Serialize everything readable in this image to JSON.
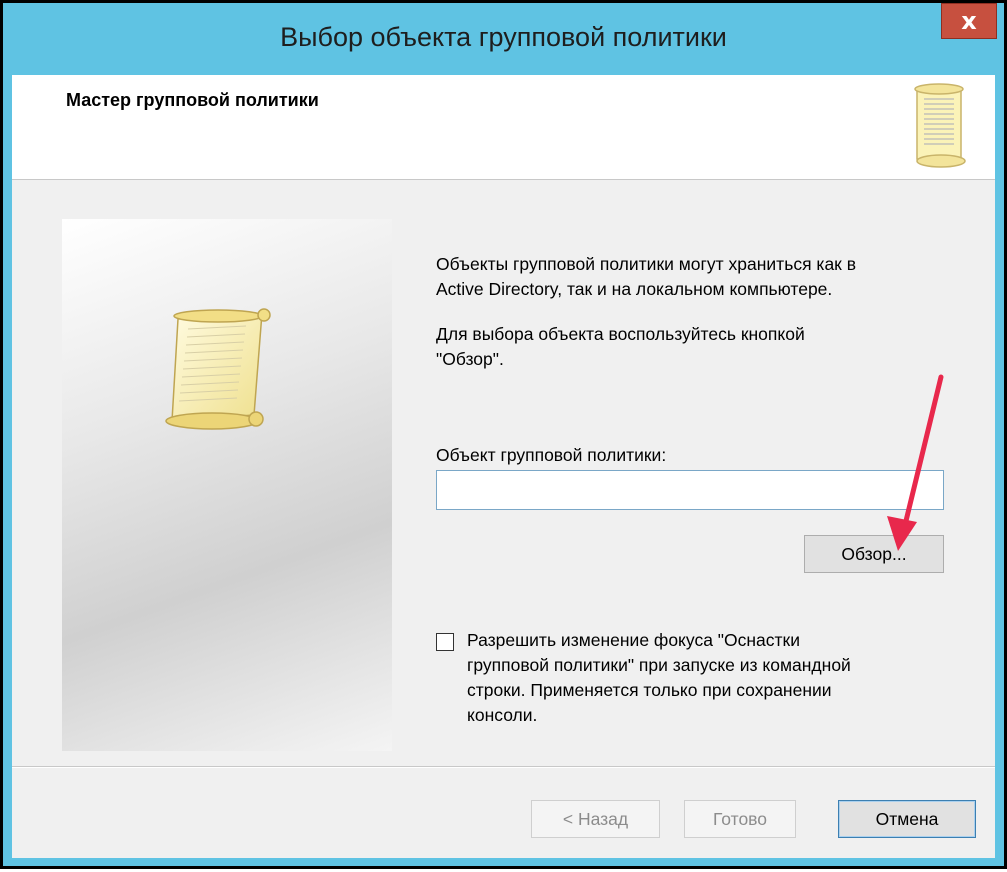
{
  "window": {
    "title": "Выбор объекта групповой политики",
    "close_label": "x",
    "frame_color": "#5fc3e3",
    "close_color": "#c7503f"
  },
  "header": {
    "title": "Мастер групповой политики",
    "icon": "scroll-icon"
  },
  "side_panel": {
    "icon": "scroll-icon"
  },
  "content": {
    "intro_text": "Объекты групповой политики могут храниться как в\nActive Directory, так и на локальном компьютере.",
    "browse_hint": "Для выбора объекта воспользуйтесь кнопкой\n\"Обзор\".",
    "gpo_label": "Объект групповой политики:",
    "gpo_value": "",
    "browse_button": "Обзор...",
    "checkbox_checked": false,
    "checkbox_label": "Разрешить изменение фокуса \"Оснастки\nгрупповой политики\" при запуске из командной\nстроки. Применяется только при сохранении\nконсоли."
  },
  "footer": {
    "back_button": "< Назад",
    "finish_button": "Готово",
    "cancel_button": "Отмена"
  },
  "annotation": {
    "type": "arrow-pointer",
    "color": "#e8284c",
    "target": "browse-button"
  }
}
